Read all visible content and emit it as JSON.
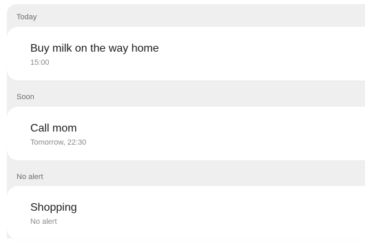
{
  "sections": [
    {
      "header": "Today",
      "reminder": {
        "title": "Buy milk on the way home",
        "subtitle": "15:00"
      }
    },
    {
      "header": "Soon",
      "reminder": {
        "title": "Call mom",
        "subtitle": "Tomorrow, 22:30"
      }
    },
    {
      "header": "No alert",
      "reminder": {
        "title": "Shopping",
        "subtitle": "No alert"
      }
    }
  ],
  "colors": {
    "background": "#efefef",
    "card": "#ffffff",
    "title_text": "#1c1c1c",
    "secondary_text": "#8a8a8a"
  }
}
